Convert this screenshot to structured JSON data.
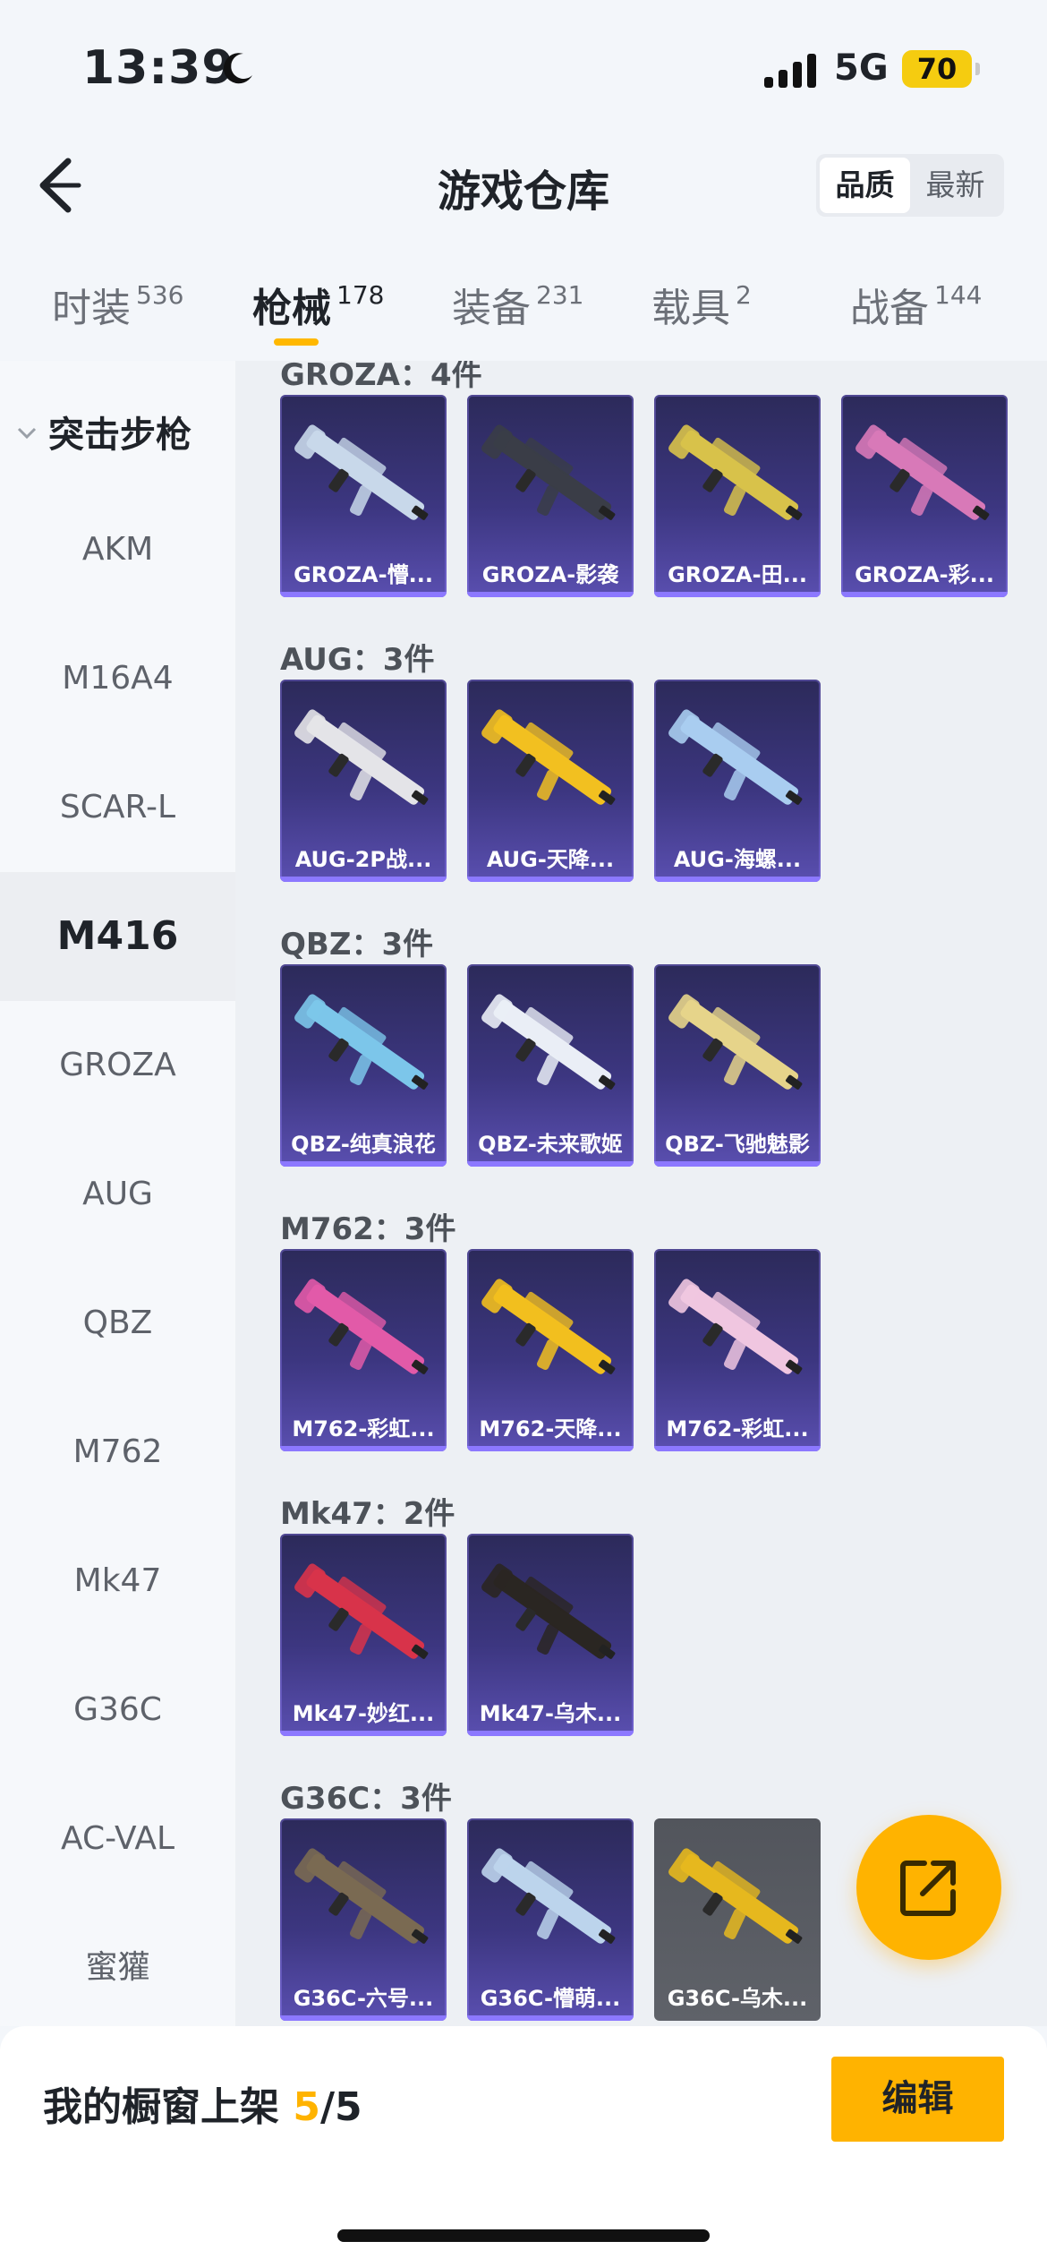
{
  "status": {
    "time": "13:39",
    "network": "5G",
    "battery": "70"
  },
  "header": {
    "title": "游戏仓库",
    "sort_options": [
      "品质",
      "最新"
    ]
  },
  "tabs": [
    {
      "name": "时装",
      "count": "536"
    },
    {
      "name": "枪械",
      "count": "178"
    },
    {
      "name": "装备",
      "count": "231"
    },
    {
      "name": "载具",
      "count": "2"
    },
    {
      "name": "战备",
      "count": "144"
    }
  ],
  "sidebar": {
    "group": "突击步枪",
    "items": [
      "AKM",
      "M16A4",
      "SCAR-L",
      "M416",
      "GROZA",
      "AUG",
      "QBZ",
      "M762",
      "Mk47",
      "G36C",
      "AC-VAL",
      "蜜獾"
    ],
    "active": "M416"
  },
  "sections": [
    {
      "label": "GROZA：4件",
      "items": [
        {
          "name": "GROZA-懵...",
          "color": "#c8d8ea"
        },
        {
          "name": "GROZA-影袭",
          "color": "#3a3d47"
        },
        {
          "name": "GROZA-田...",
          "color": "#d8c24a"
        },
        {
          "name": "GROZA-彩...",
          "color": "#d879b8"
        }
      ]
    },
    {
      "label": "AUG：3件",
      "items": [
        {
          "name": "AUG-2P战...",
          "color": "#e4e4e8"
        },
        {
          "name": "AUG-天降...",
          "color": "#f2c020"
        },
        {
          "name": "AUG-海螺...",
          "color": "#a9cdf0"
        }
      ]
    },
    {
      "label": "QBZ：3件",
      "items": [
        {
          "name": "QBZ-纯真浪花",
          "color": "#7cc6ea"
        },
        {
          "name": "QBZ-未来歌姬",
          "color": "#eaeef6"
        },
        {
          "name": "QBZ-飞驰魅影",
          "color": "#e6d48a"
        }
      ]
    },
    {
      "label": "M762：3件",
      "items": [
        {
          "name": "M762-彩虹...",
          "color": "#e25aa8"
        },
        {
          "name": "M762-天降...",
          "color": "#f2bf1e"
        },
        {
          "name": "M762-彩虹...",
          "color": "#f0c6e0"
        }
      ]
    },
    {
      "label": "Mk47：2件",
      "items": [
        {
          "name": "Mk47-妙红...",
          "color": "#d8334a"
        },
        {
          "name": "Mk47-乌木...",
          "color": "#2a2622"
        }
      ]
    },
    {
      "label": "G36C：3件",
      "items": [
        {
          "name": "G36C-六号...",
          "color": "#7a6a52"
        },
        {
          "name": "G36C-懵萌...",
          "color": "#bcd4ec"
        },
        {
          "name": "G36C-乌木...",
          "color": "#e6b81e",
          "grey": true
        }
      ]
    }
  ],
  "footer": {
    "showcase_label": "我的橱窗上架",
    "showcase_used": "5",
    "showcase_total": "/5",
    "edit_label": "编辑"
  }
}
